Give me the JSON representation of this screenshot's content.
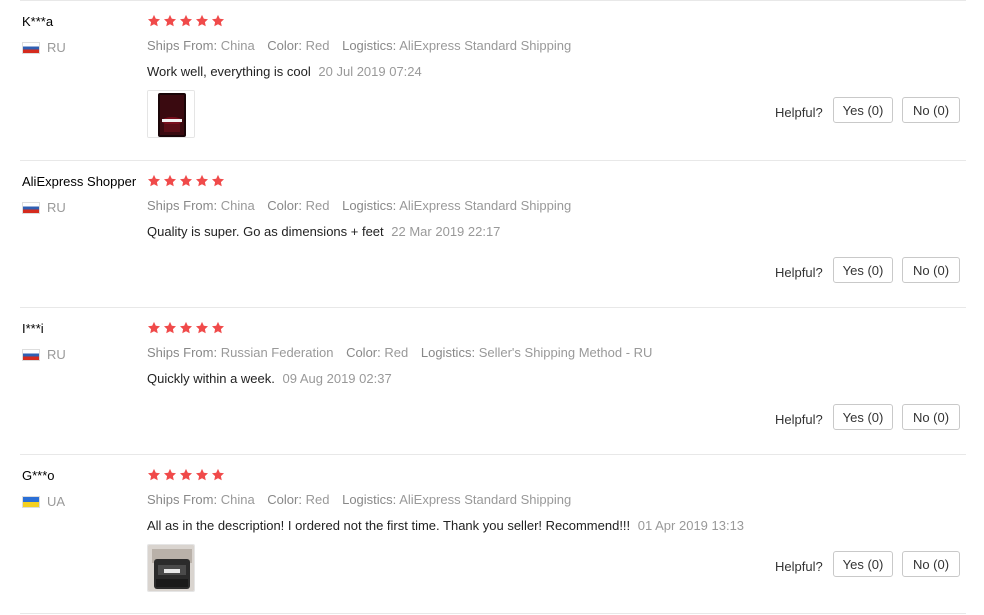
{
  "labels": {
    "ships_from": "Ships From:",
    "color": "Color:",
    "logistics": "Logistics:",
    "helpful": "Helpful?"
  },
  "colors": {
    "star": "#f04a4a"
  },
  "reviews": [
    {
      "user": "K***a",
      "country": "RU",
      "stars": 5,
      "ships_from": "China",
      "color": "Red",
      "logistics": "AliExpress Standard Shipping",
      "comment": "Work well, everything is cool",
      "date": "20 Jul 2019 07:24",
      "has_photo": true,
      "yes_label": "Yes (0)",
      "no_label": "No (0)"
    },
    {
      "user": "AliExpress Shopper",
      "country": "RU",
      "stars": 5,
      "ships_from": "China",
      "color": "Red",
      "logistics": "AliExpress Standard Shipping",
      "comment": "Quality is super. Go as dimensions + feet",
      "date": "22 Mar 2019 22:17",
      "has_photo": false,
      "yes_label": "Yes (0)",
      "no_label": "No (0)"
    },
    {
      "user": "I***i",
      "country": "RU",
      "stars": 5,
      "ships_from": "Russian Federation",
      "color": "Red",
      "logistics": "Seller's Shipping Method - RU",
      "comment": "Quickly within a week.",
      "date": "09 Aug 2019 02:37",
      "has_photo": false,
      "yes_label": "Yes (0)",
      "no_label": "No (0)"
    },
    {
      "user": "G***o",
      "country": "UA",
      "stars": 5,
      "ships_from": "China",
      "color": "Red",
      "logistics": "AliExpress Standard Shipping",
      "comment": "All as in the description! I ordered not the first time. Thank you seller! Recommend!!!",
      "date": "01 Apr 2019 13:13",
      "has_photo": true,
      "yes_label": "Yes (0)",
      "no_label": "No (0)"
    }
  ]
}
